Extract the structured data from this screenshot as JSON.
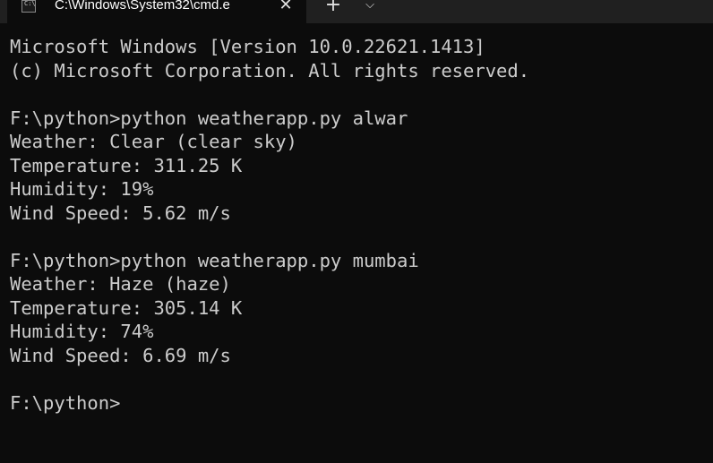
{
  "window": {
    "tab": {
      "title": "C:\\Windows\\System32\\cmd.e",
      "icon": "cmd-icon",
      "icon_glyph": "C:\\",
      "close_glyph": "✕"
    },
    "new_tab_glyph": "+",
    "dropdown_glyph": "⌵"
  },
  "terminal": {
    "lines": [
      "Microsoft Windows [Version 10.0.22621.1413]",
      "(c) Microsoft Corporation. All rights reserved.",
      "",
      "F:\\python>python weatherapp.py alwar",
      "Weather: Clear (clear sky)",
      "Temperature: 311.25 K",
      "Humidity: 19%",
      "Wind Speed: 5.62 m/s",
      "",
      "F:\\python>python weatherapp.py mumbai",
      "Weather: Haze (haze)",
      "Temperature: 305.14 K",
      "Humidity: 74%",
      "Wind Speed: 6.69 m/s",
      "",
      "F:\\python>"
    ]
  },
  "colors": {
    "background": "#0c0c0c",
    "text": "#cccccc",
    "tabbar": "#202020"
  }
}
